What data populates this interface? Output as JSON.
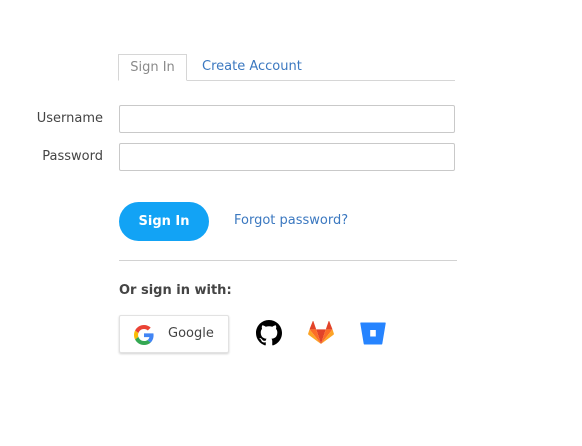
{
  "tabs": {
    "signin_label": "Sign In",
    "create_label": "Create Account"
  },
  "form": {
    "username_label": "Username",
    "username_value": "",
    "password_label": "Password",
    "password_value": ""
  },
  "actions": {
    "signin_button": "Sign In",
    "forgot_link": "Forgot password?"
  },
  "social": {
    "heading": "Or sign in with:",
    "google_label": "Google",
    "icons": [
      "google-icon",
      "github-icon",
      "gitlab-icon",
      "bitbucket-icon"
    ]
  },
  "colors": {
    "primary": "#12a3f5",
    "link": "#3b78c0",
    "github": "#000000",
    "gitlab": "#e24329",
    "bitbucket": "#2684ff"
  }
}
